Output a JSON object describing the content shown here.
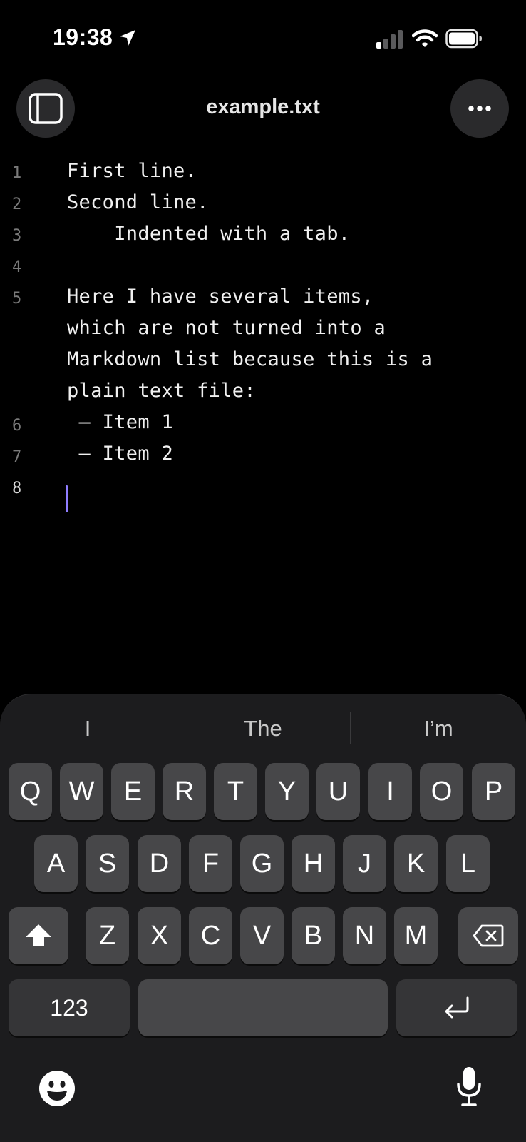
{
  "status_bar": {
    "time": "19:38",
    "icons": [
      "location-arrow-icon",
      "cellular-signal-icon",
      "wifi-icon",
      "battery-icon"
    ]
  },
  "header": {
    "title": "example.txt",
    "left_button_icon": "sidebar-toggle-icon",
    "right_button_icon": "more-options-icon"
  },
  "editor": {
    "line_numbers": [
      "1",
      "2",
      "3",
      "4",
      "5",
      "6",
      "7",
      "8"
    ],
    "current_line": "8",
    "lines": [
      "First line.",
      "Second line.",
      "    Indented with a tab.",
      "",
      "Here I have several items,",
      "which are not turned into a",
      "Markdown list because this is a",
      "plain text file:",
      " – Item 1",
      " – Item 2",
      ""
    ],
    "cursor_color": "#8f7dff"
  },
  "keyboard": {
    "suggestions": [
      "I",
      "The",
      "I’m"
    ],
    "row1": [
      "Q",
      "W",
      "E",
      "R",
      "T",
      "Y",
      "U",
      "I",
      "O",
      "P"
    ],
    "row2": [
      "A",
      "S",
      "D",
      "F",
      "G",
      "H",
      "J",
      "K",
      "L"
    ],
    "row3": [
      "Z",
      "X",
      "C",
      "V",
      "B",
      "N",
      "M"
    ],
    "numbers_key": "123",
    "shift_icon": "shift-icon",
    "delete_icon": "delete-icon",
    "return_icon": "return-icon",
    "emoji_icon": "emoji-icon",
    "mic_icon": "microphone-icon"
  }
}
